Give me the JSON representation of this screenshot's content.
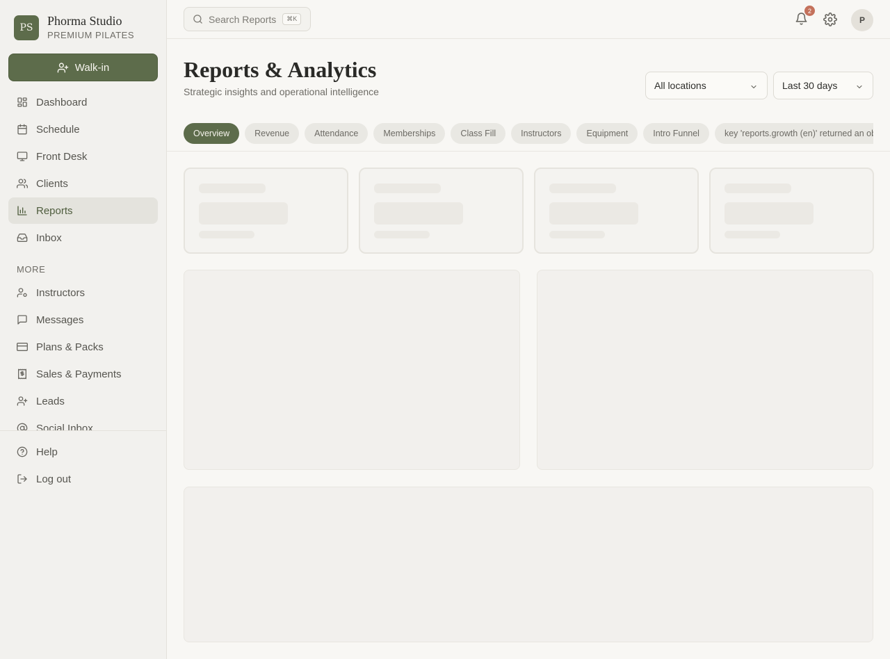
{
  "brand": {
    "initials": "PS",
    "name": "Phorma Studio",
    "subtitle": "PREMIUM PILATES"
  },
  "walkin": {
    "label": "Walk-in"
  },
  "nav": {
    "main": [
      {
        "label": "Dashboard",
        "icon": "dashboard-icon"
      },
      {
        "label": "Schedule",
        "icon": "calendar-icon"
      },
      {
        "label": "Front Desk",
        "icon": "monitor-icon"
      },
      {
        "label": "Clients",
        "icon": "users-icon"
      },
      {
        "label": "Reports",
        "icon": "bar-chart-icon",
        "active": true
      },
      {
        "label": "Inbox",
        "icon": "inbox-icon"
      }
    ],
    "more_label": "MORE",
    "more": [
      {
        "label": "Instructors",
        "icon": "user-cog-icon"
      },
      {
        "label": "Messages",
        "icon": "message-icon"
      },
      {
        "label": "Plans & Packs",
        "icon": "credit-card-icon"
      },
      {
        "label": "Sales & Payments",
        "icon": "receipt-icon"
      },
      {
        "label": "Leads",
        "icon": "user-plus-icon"
      },
      {
        "label": "Social Inbox",
        "icon": "at-sign-icon"
      }
    ],
    "footer": [
      {
        "label": "Help",
        "icon": "help-circle-icon"
      },
      {
        "label": "Log out",
        "icon": "log-out-icon"
      }
    ]
  },
  "topbar": {
    "search_placeholder": "Search Reports",
    "shortcut": "⌘K",
    "notification_count": "2",
    "avatar_initial": "P"
  },
  "header": {
    "title": "Reports & Analytics",
    "subtitle": "Strategic insights and operational intelligence"
  },
  "filters": {
    "location": "All locations",
    "range": "Last 30 days"
  },
  "tabs": [
    {
      "label": "Overview",
      "active": true
    },
    {
      "label": "Revenue"
    },
    {
      "label": "Attendance"
    },
    {
      "label": "Memberships"
    },
    {
      "label": "Class Fill"
    },
    {
      "label": "Instructors"
    },
    {
      "label": "Equipment"
    },
    {
      "label": "Intro Funnel"
    },
    {
      "label": "key 'reports.growth (en)' returned an object instead of string."
    }
  ],
  "colors": {
    "accent": "#5d6c4b",
    "badge": "#c4715b",
    "background": "#f8f7f4",
    "sidebar": "#f2f1ee"
  }
}
